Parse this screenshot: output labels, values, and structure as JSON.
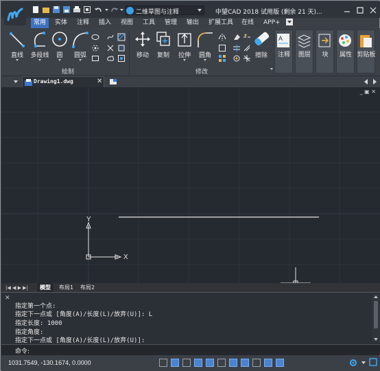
{
  "app": {
    "title": "中望CAD 2018 试用版 (剩余 21 天)...",
    "workspace": "二维草图与注释"
  },
  "menu_tabs": [
    "常用",
    "实体",
    "注释",
    "插入",
    "视图",
    "工具",
    "管理",
    "输出",
    "扩展工具",
    "在线",
    "APP+"
  ],
  "ribbon": {
    "draw_tools": [
      "直线",
      "多段线",
      "圆",
      "圆弧"
    ],
    "modify_tools": [
      "移动",
      "复制",
      "拉伸",
      "圆角",
      "擦除"
    ],
    "right_tools": [
      "注释",
      "图层",
      "块",
      "属性",
      "剪贴板"
    ],
    "panels": {
      "draw": "绘制",
      "modify": "修改"
    }
  },
  "document": {
    "tab_name": "Drawing1.dwg"
  },
  "canvas": {
    "ucs_x": "X",
    "ucs_y": "Y"
  },
  "layout_tabs": [
    "模型",
    "布局1",
    "布局2"
  ],
  "command_history": [
    "指定第一个点:",
    "指定下一点或 [角度(A)/长度(L)/放弃(U)]: L",
    "指定长度: 1000",
    "指定角度:",
    "指定下一点或 [角度(A)/长度(L)/放弃(U)]:"
  ],
  "prompt": "命令:",
  "status": {
    "coordinates": "1031.7549, -130.1674, 0.0000"
  },
  "colors": {
    "accent": "#3e73c4",
    "canvas": "#252a30",
    "ribbon": "#3c4148"
  }
}
